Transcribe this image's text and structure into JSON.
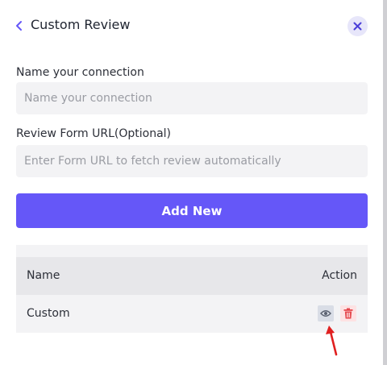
{
  "header": {
    "title": "Custom Review",
    "back_icon": "chevron-left-icon",
    "close_icon": "close-icon"
  },
  "form": {
    "name_label": "Name your connection",
    "name_placeholder": "Name your connection",
    "name_value": "",
    "url_label": "Review Form URL(Optional)",
    "url_placeholder": "Enter Form URL to fetch review automatically",
    "url_value": "",
    "add_button_label": "Add New"
  },
  "table": {
    "columns": [
      "Name",
      "Action"
    ],
    "rows": [
      {
        "name": "Custom",
        "actions": [
          "eye-icon",
          "trash-icon"
        ]
      }
    ]
  },
  "colors": {
    "accent": "#6557f8",
    "close_bg": "#e7e6fa",
    "danger": "#e5484d",
    "annotation_arrow": "#e02020"
  }
}
